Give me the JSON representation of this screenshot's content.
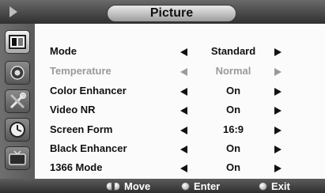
{
  "title": "Picture",
  "sidebar": {
    "icons": [
      "picture-icon",
      "audio-icon",
      "tools-icon",
      "clock-icon",
      "tv-icon"
    ],
    "active": "picture-icon"
  },
  "menu": {
    "rows": [
      {
        "label": "Mode",
        "value": "Standard",
        "enabled": true
      },
      {
        "label": "Temperature",
        "value": "Normal",
        "enabled": false
      },
      {
        "label": "Color Enhancer",
        "value": "On",
        "enabled": true
      },
      {
        "label": "Video NR",
        "value": "On",
        "enabled": true
      },
      {
        "label": "Screen Form",
        "value": "16:9",
        "enabled": true
      },
      {
        "label": "Black Enhancer",
        "value": "On",
        "enabled": true
      },
      {
        "label": "1366 Mode",
        "value": "On",
        "enabled": true
      }
    ]
  },
  "footer": {
    "move": "Move",
    "enter": "Enter",
    "exit": "Exit"
  },
  "colors": {
    "panel_bg": "#fbfbfb",
    "chrome_dark": "#2f2f2f",
    "disabled_text": "#9a9a9a"
  }
}
